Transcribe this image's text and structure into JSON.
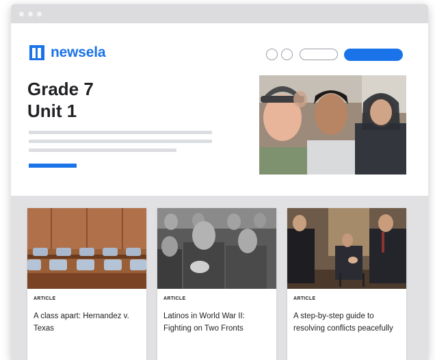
{
  "logo": {
    "text": "newsela"
  },
  "hero": {
    "title_line1": "Grade 7",
    "title_line2": "Unit 1"
  },
  "cards": [
    {
      "kind": "ARTICLE",
      "title": "A class apart: Hernandez v. Texas"
    },
    {
      "kind": "ARTICLE",
      "title": "Latinos in World War II: Fighting on Two Fronts"
    },
    {
      "kind": "ARTICLE",
      "title": "A step-by-step guide to resolving conflicts peacefully"
    }
  ],
  "colors": {
    "brand_blue": "#1a73e8",
    "page_gray": "#e1e1e3"
  },
  "icons": [
    "newsela-logo-icon"
  ]
}
